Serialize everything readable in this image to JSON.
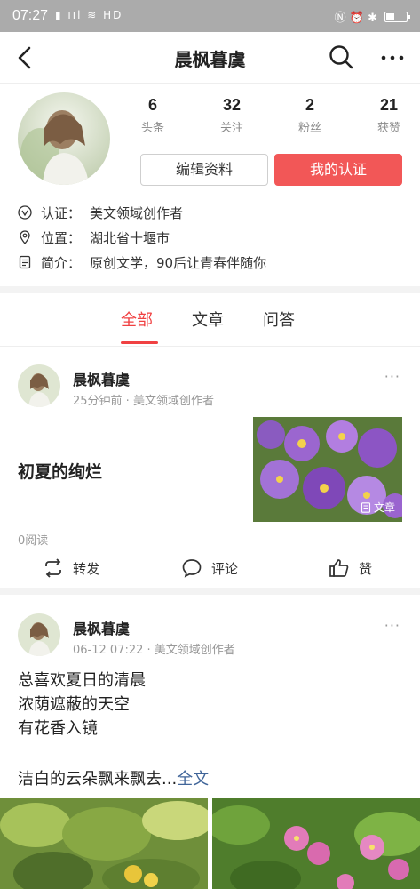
{
  "status_bar": {
    "time": "07:27",
    "left_icons": "▮ ııl ≋ HD",
    "right_icons": "Ⓝ ⏰ ✱",
    "battery_percent": 45
  },
  "header": {
    "title": "晨枫暮虞",
    "back_icon": "chevron-left-icon",
    "search_icon": "search-icon",
    "more_icon": "more-horizontal-icon"
  },
  "profile": {
    "stats": [
      {
        "value": "6",
        "label": "头条"
      },
      {
        "value": "32",
        "label": "关注"
      },
      {
        "value": "2",
        "label": "粉丝"
      },
      {
        "value": "21",
        "label": "获赞"
      }
    ],
    "edit_button": "编辑资料",
    "certify_button": "我的认证",
    "certify_color": "#f25757",
    "info": {
      "cert_key": "认证：",
      "cert_value": "美文领域创作者",
      "location_key": "位置：",
      "location_value": "湖北省十堰市",
      "bio_key": "简介：",
      "bio_value": "原创文学，90后让青春伴随你"
    }
  },
  "tabs": [
    {
      "label": "全部",
      "active": true
    },
    {
      "label": "文章",
      "active": false
    },
    {
      "label": "问答",
      "active": false
    }
  ],
  "accent_color": "#f04142",
  "posts": [
    {
      "author": "晨枫暮虞",
      "meta": "25分钟前 · 美文领域创作者",
      "more": "···",
      "title": "初夏的绚烂",
      "thumb_badge": "文章",
      "read_count": "0阅读",
      "actions": {
        "repost": "转发",
        "comment": "评论",
        "like": "赞"
      }
    },
    {
      "author": "晨枫暮虞",
      "meta": "06-12 07:22 · 美文领域创作者",
      "more": "···",
      "lines": [
        "总喜欢夏日的清晨",
        "浓荫遮蔽的天空",
        "有花香入镜"
      ],
      "last_line": "洁白的云朵飘来飘去...",
      "full_text_link": "全文"
    }
  ]
}
